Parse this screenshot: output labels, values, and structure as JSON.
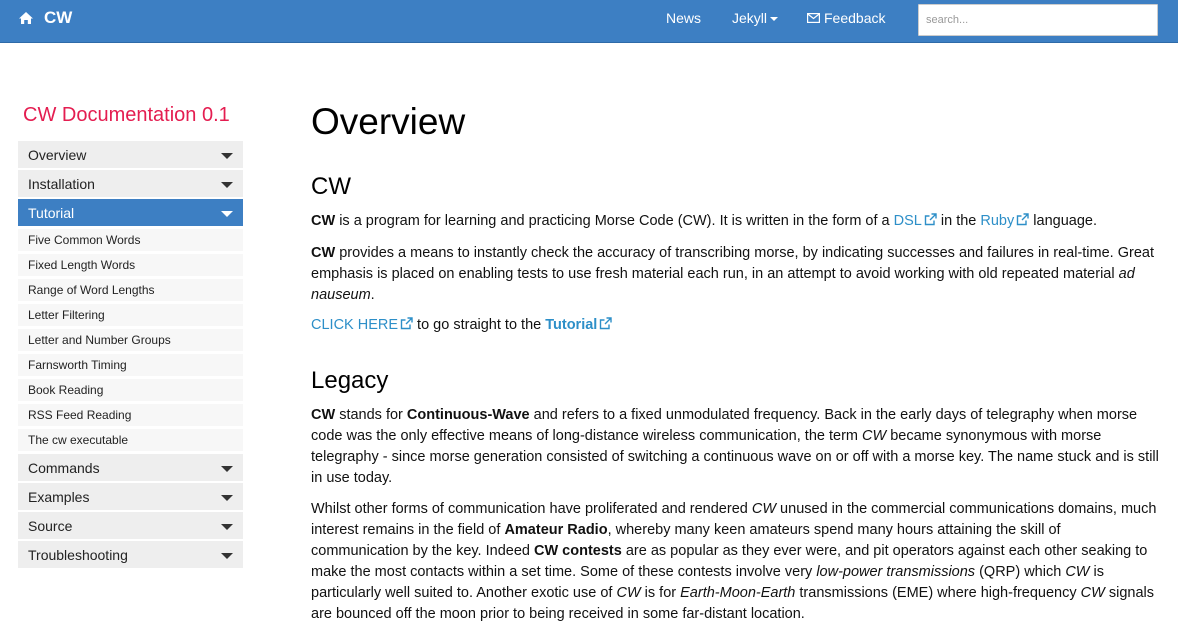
{
  "navbar": {
    "brand": "CW",
    "links": {
      "news": "News",
      "jekyll": "Jekyll",
      "feedback": "Feedback"
    },
    "search_placeholder": "search..."
  },
  "sidebar": {
    "title": "CW Documentation 0.1",
    "top_items": [
      "Overview",
      "Installation",
      "Tutorial"
    ],
    "sub_items": [
      "Five Common Words",
      "Fixed Length Words",
      "Range of Word Lengths",
      "Letter Filtering",
      "Letter and Number Groups",
      "Farnsworth Timing",
      "Book Reading",
      "RSS Feed Reading",
      "The cw executable"
    ],
    "bottom_items": [
      "Commands",
      "Examples",
      "Source",
      "Troubleshooting"
    ]
  },
  "content": {
    "title": "Overview",
    "section_cw": {
      "heading": "CW",
      "p1": {
        "bold": "CW",
        "t1": " is a program for learning and practicing Morse Code (CW). It is written in the form of a ",
        "link1": "DSL",
        "t2": " in the ",
        "link2": "Ruby",
        "t3": " language."
      },
      "p2": {
        "bold": "CW",
        "t1": " provides a means to instantly check the accuracy of transcribing morse, by indicating successes and failures in real-time. Great emphasis is placed on enabling tests to use fresh material each run, in an attempt to avoid working with old repeated material ",
        "em": "ad nauseum",
        "t2": "."
      },
      "p3": {
        "link1": "CLICK HERE",
        "t1": " to go straight to the ",
        "link2": "Tutorial"
      }
    },
    "section_legacy": {
      "heading": "Legacy",
      "p1": {
        "b1": "CW",
        "t1": " stands for ",
        "b2": "Continuous-Wave",
        "t2": " and refers to a fixed unmodulated frequency. Back in the early days of telegraphy when morse code was the only effective means of long-distance wireless communication, the term ",
        "em1": "CW",
        "t3": " became synonymous with morse telegraphy - since morse generation consisted of switching a continuous wave on or off with a morse key. The name stuck and is still in use today."
      },
      "p2": {
        "t1": "Whilst other forms of communication have proliferated and rendered ",
        "em1": "CW",
        "t2": " unused in the commercial communications domains, much interest remains in the field of ",
        "b1": "Amateur Radio",
        "t3": ", whereby many keen amateurs spend many hours attaining the skill of communication by the key. Indeed ",
        "b2": "CW contests",
        "t4": " are as popular as they ever were, and pit operators against each other seaking to make the most contacts within a set time. Some of these contests involve very ",
        "em2": "low-power transmissions",
        "t5": " (QRP) which ",
        "em3": "CW",
        "t6": " is particularly well suited to. Another exotic use of ",
        "em4": "CW",
        "t7": " is for ",
        "em5": "Earth-Moon-Earth",
        "t8": " transmissions (EME) where high-frequency ",
        "em6": "CW",
        "t9": " signals are bounced off the moon prior to being received in some far-distant location."
      }
    }
  },
  "colors": {
    "navbar": "#3d7fc3",
    "sidebar_title": "#e41d50",
    "link": "#2d8fc8",
    "active_item": "#3d7fc3"
  }
}
